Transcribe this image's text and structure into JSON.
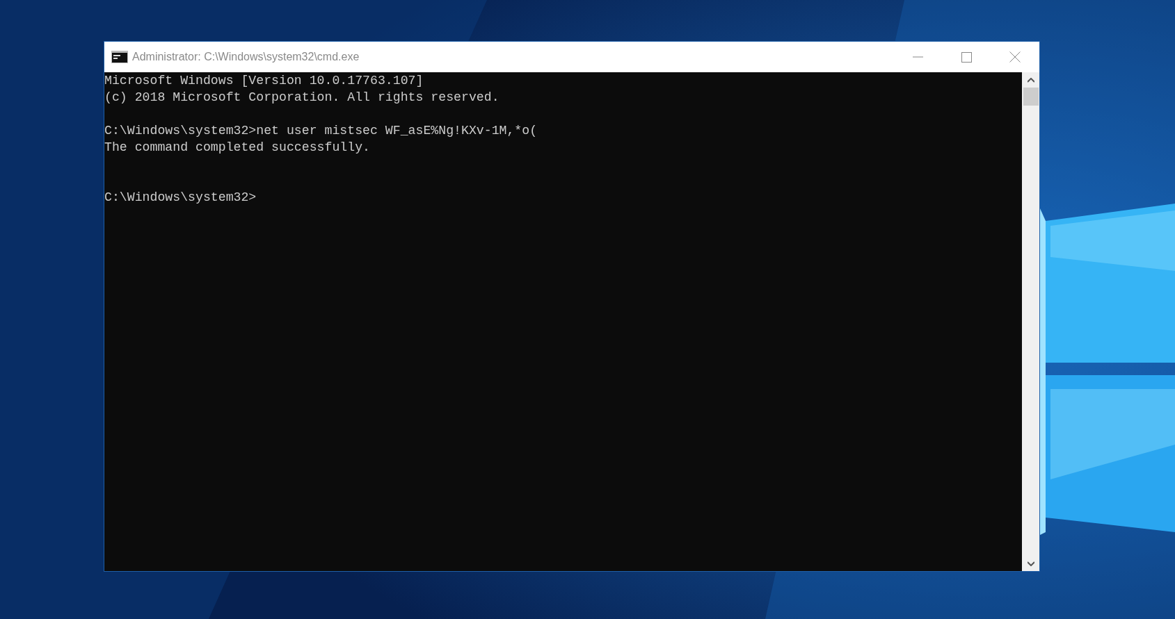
{
  "window": {
    "title": "Administrator: C:\\Windows\\system32\\cmd.exe"
  },
  "console": {
    "lines": [
      {
        "kind": "banner",
        "text": "Microsoft Windows [Version 10.0.17763.107]"
      },
      {
        "kind": "banner",
        "text": "(c) 2018 Microsoft Corporation. All rights reserved."
      },
      {
        "kind": "command",
        "text": "C:\\Windows\\system32>net user mistsec WF_asE%Ng!KXv-1M,*o("
      },
      {
        "kind": "output",
        "text": "The command completed successfully."
      },
      {
        "kind": "prompt",
        "text": "C:\\Windows\\system32>"
      }
    ]
  }
}
